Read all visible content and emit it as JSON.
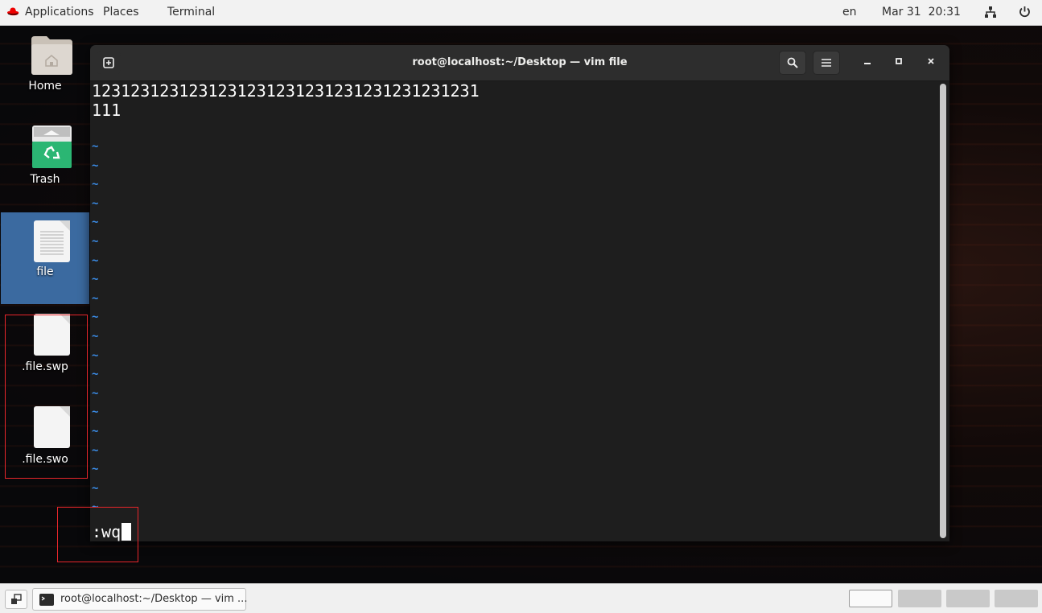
{
  "topbar": {
    "applications": "Applications",
    "places": "Places",
    "terminal": "Terminal",
    "language": "en",
    "datetime": "Mar 31  20:31"
  },
  "desktop": {
    "icons": [
      {
        "label": "Home"
      },
      {
        "label": "Trash"
      },
      {
        "label": "file"
      },
      {
        "label": ".file.swp"
      },
      {
        "label": ".file.swo"
      }
    ]
  },
  "terminal": {
    "title": "root@localhost:~/Desktop — vim file",
    "lines": [
      "1231231231231231231231231231231231231231",
      "111"
    ],
    "tilde": "~",
    "command": ":wq"
  },
  "taskbar": {
    "task_label": "root@localhost:~/Desktop — vim ..."
  },
  "colors": {
    "tilde": "#3b8eea",
    "selection": "#3b6aa0",
    "highlight_box": "#e8262b"
  }
}
